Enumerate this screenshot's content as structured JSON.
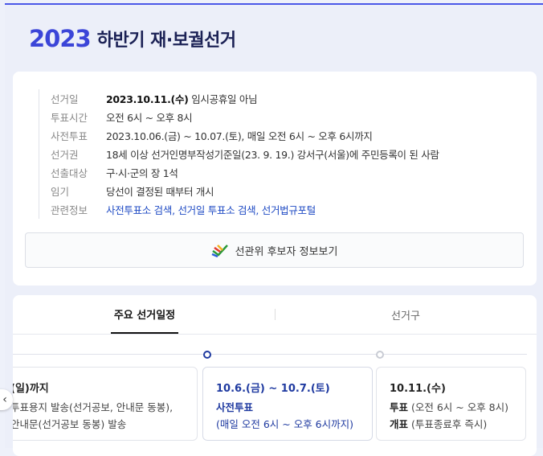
{
  "page": {
    "title_year": "2023",
    "title_text": "하반기 재·보궐선거"
  },
  "info": {
    "rows": [
      {
        "label": "선거일",
        "value_bold": "2023.10.11.(수)",
        "value": " 임시공휴일 아님"
      },
      {
        "label": "투표시간",
        "value": "오전 6시 ~ 오후 8시"
      },
      {
        "label": "사전투표",
        "value": "2023.10.06.(금) ~ 10.07.(토), 매일 오전 6시 ~ 오후 6시까지"
      },
      {
        "label": "선거권",
        "value": "18세 이상 선거인명부작성기준일(23. 9. 19.) 강서구(서울)에 주민등록이 된 사람"
      },
      {
        "label": "선출대상",
        "value": "구·시·군의 장 1석"
      },
      {
        "label": "임기",
        "value": "당선이 결정된 때부터 개시"
      }
    ],
    "related_label": "관련정보",
    "related_links": [
      "사전투표소 검색",
      "선거일 투표소 검색",
      "선거법규포털"
    ],
    "candidate_button": "선관위 후보자 정보보기"
  },
  "schedule": {
    "tabs": [
      "주요 선거일정",
      "선거구"
    ],
    "active_tab": 0,
    "events": [
      {
        "date": "(일)까지",
        "lines": [
          "투표용지 발송(선거공보, 안내문 동봉),",
          "안내문(선거공보 동봉) 발송"
        ]
      },
      {
        "date": "10.6.(금) ~ 10.7.(토)",
        "head": "사전투표",
        "sub": "(매일 오전 6시 ~ 오후 6시까지)"
      },
      {
        "date": "10.11.(수)",
        "line1_bold": "투표",
        "line1": " (오전 6시 ~ 오후 8시)",
        "line2_bold": "개표",
        "line2": " (투표종료후 즉시)"
      }
    ]
  },
  "colors": {
    "accent": "#3b45d8",
    "title_dark": "#1b2155",
    "link": "#1f4bc4",
    "active_event": "#1f3aa0"
  }
}
